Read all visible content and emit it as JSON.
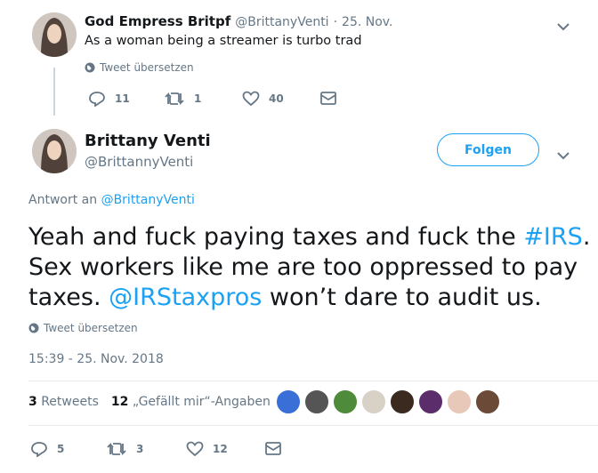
{
  "parent_tweet": {
    "display_name": "God Empress Britpf",
    "handle": "@BrittanyVenti",
    "separator": "·",
    "date": "25. Nov.",
    "text": "As a woman being a streamer is turbo trad",
    "translate_label": "Tweet übersetzen",
    "reply_count": "11",
    "retweet_count": "1",
    "like_count": "40"
  },
  "main_tweet": {
    "display_name": "Brittany Venti",
    "handle": "@BrittannyVenti",
    "follow_label": "Folgen",
    "reply_prefix": "Antwort an",
    "reply_handle": "@BrittanyVenti",
    "text_part1": "Yeah and fuck paying taxes and fuck the ",
    "hashtag": "#IRS",
    "text_part2": ". Sex workers like me are too oppressed to pay taxes. ",
    "mention": "@IRStaxpros",
    "text_part3": " won’t dare to audit us.",
    "translate_label": "Tweet übersetzen",
    "timestamp": "15:39 - 25. Nov. 2018",
    "retweets_count": "3",
    "retweets_label": "Retweets",
    "likes_count": "12",
    "likes_label": "„Gefällt mir“-Angaben",
    "reply_count": "5",
    "retweet_count": "3",
    "like_count": "12"
  },
  "colors": {
    "accent": "#1da1f2",
    "secondary_text": "#657786",
    "primary_text": "#14171a",
    "thread_line": "#c9d6e2"
  },
  "liker_avatars": [
    "#3a6fd8",
    "#555555",
    "#4e8b3a",
    "#d8d2c6",
    "#3b2a1f",
    "#5b2d6b",
    "#e8c8b8",
    "#6b4a38"
  ]
}
